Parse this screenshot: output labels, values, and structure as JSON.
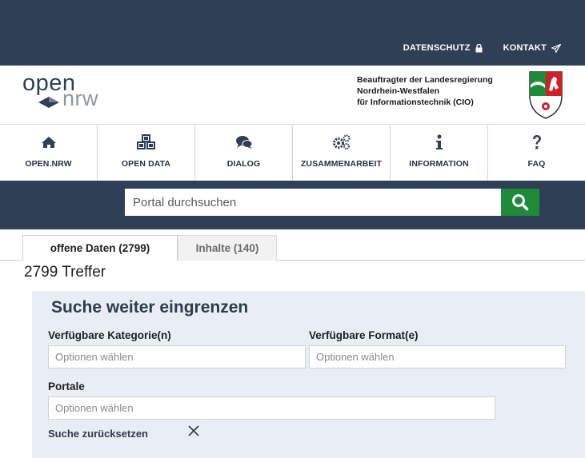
{
  "header": {
    "links": [
      {
        "label": "DATENSCHUTZ",
        "icon": "lock-icon"
      },
      {
        "label": "KONTAKT",
        "icon": "paper-plane-icon"
      }
    ]
  },
  "brand": {
    "logo_open": "open",
    "logo_nrw": "nrw",
    "cio_line1": "Beauftragter der Landesregierung",
    "cio_line2": "Nordrhein-Westfalen",
    "cio_line3": "für Informationstechnik (CIO)",
    "crest": "nrw-coat-of-arms"
  },
  "nav": {
    "items": [
      {
        "label": "OPEN.NRW",
        "icon": "home-icon"
      },
      {
        "label": "OPEN DATA",
        "icon": "cubes-icon"
      },
      {
        "label": "DIALOG",
        "icon": "chat-bubbles-icon"
      },
      {
        "label": "ZUSAMMENARBEIT",
        "icon": "gears-icon"
      },
      {
        "label": "INFORMATION",
        "icon": "info-icon"
      },
      {
        "label": "FAQ",
        "icon": "question-icon"
      }
    ]
  },
  "search": {
    "placeholder": "Portal durchsuchen",
    "button_icon": "search-icon"
  },
  "tabs": [
    {
      "label": "offene Daten (2799)",
      "active": true
    },
    {
      "label": "Inhalte (140)",
      "active": false
    }
  ],
  "results": {
    "count_text": "2799 Treffer"
  },
  "filters": {
    "title": "Suche weiter eingrenzen",
    "category_label": "Verfügbare Kategorie(n)",
    "category_placeholder": "Optionen wählen",
    "format_label": "Verfügbare Format(e)",
    "format_placeholder": "Optionen wählen",
    "portals_label": "Portale",
    "portals_placeholder": "Optionen wählen",
    "reset_label": "Suche zurücksetzen"
  },
  "colors": {
    "header_bg": "#2f3f56",
    "search_button": "#1f8a3a",
    "filter_bg": "#e9eef5"
  }
}
